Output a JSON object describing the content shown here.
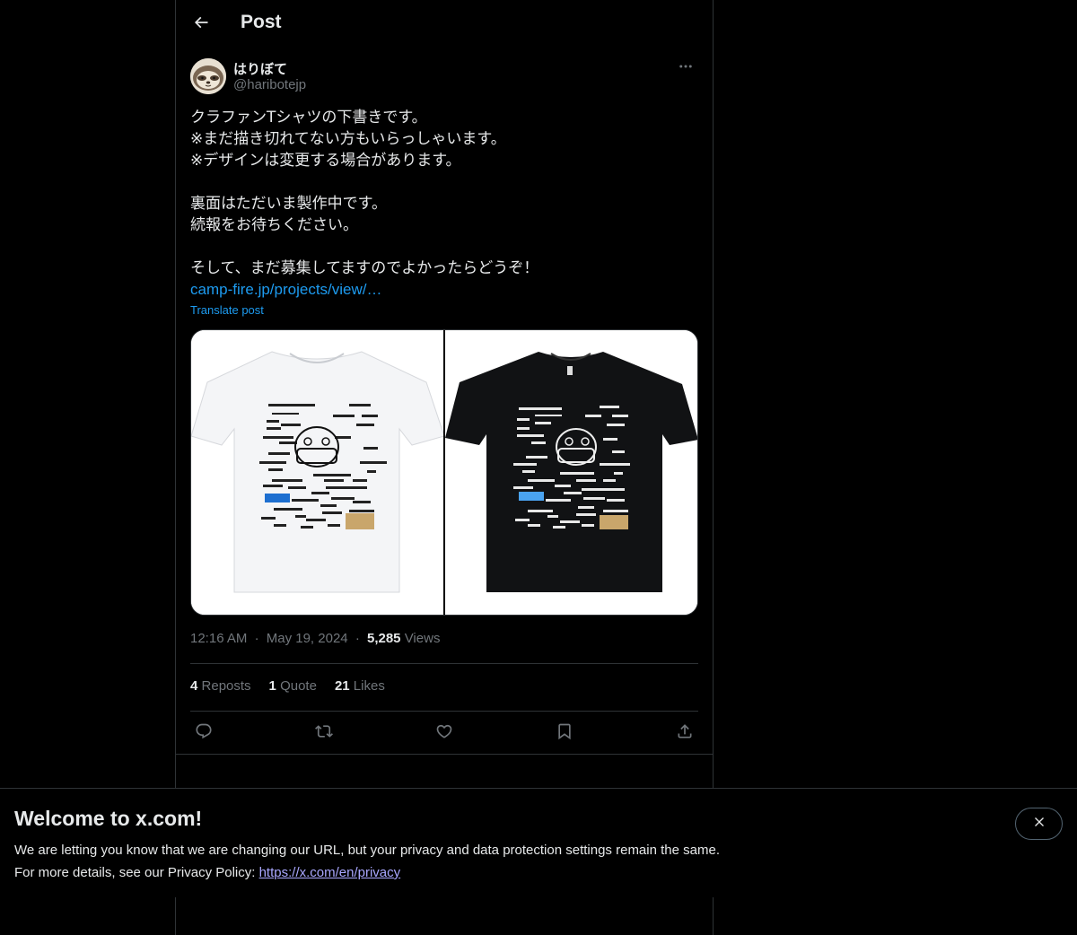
{
  "header": {
    "title": "Post"
  },
  "author": {
    "display_name": "はりぼて",
    "handle": "@haribotejp"
  },
  "tweet": {
    "lines": [
      "クラファンTシャツの下書きです。",
      "※まだ描き切れてない方もいらっしゃいます。",
      "※デザインは変更する場合があります。",
      "",
      "裏面はただいま製作中です。",
      "続報をお待ちください。",
      "",
      "そして、まだ募集してますのでよかったらどうぞ！"
    ],
    "link_text": "camp-fire.jp/projects/view/…",
    "translate_label": "Translate post"
  },
  "media": {
    "left_alt": "White T-shirt design draft",
    "right_alt": "Black T-shirt design draft",
    "left_bg": "#ffffff",
    "right_bg": "#ffffff"
  },
  "meta": {
    "time": "12:16 AM",
    "sep1": "·",
    "date": "May 19, 2024",
    "sep2": "·",
    "views_count": "5,285",
    "views_label": "Views"
  },
  "stats": {
    "reposts_count": "4",
    "reposts_label": "Reposts",
    "quotes_count": "1",
    "quotes_label": "Quote",
    "likes_count": "21",
    "likes_label": "Likes"
  },
  "actions": [
    "reply-icon",
    "repost-icon",
    "like-icon",
    "bookmark-icon",
    "share-icon"
  ],
  "banner": {
    "title": "Welcome to x.com!",
    "line1": "We are letting you know that we are changing our URL, but your privacy and data protection settings remain the same.",
    "line2_prefix": "For more details, see our Privacy Policy: ",
    "line2_link": "https://x.com/en/privacy"
  },
  "colors": {
    "background": "#000000",
    "text": "#e7e9ea",
    "secondary": "#71767b",
    "accent": "#1d9bf0",
    "border": "#2f3336",
    "banner_link": "#a9a7ff"
  }
}
